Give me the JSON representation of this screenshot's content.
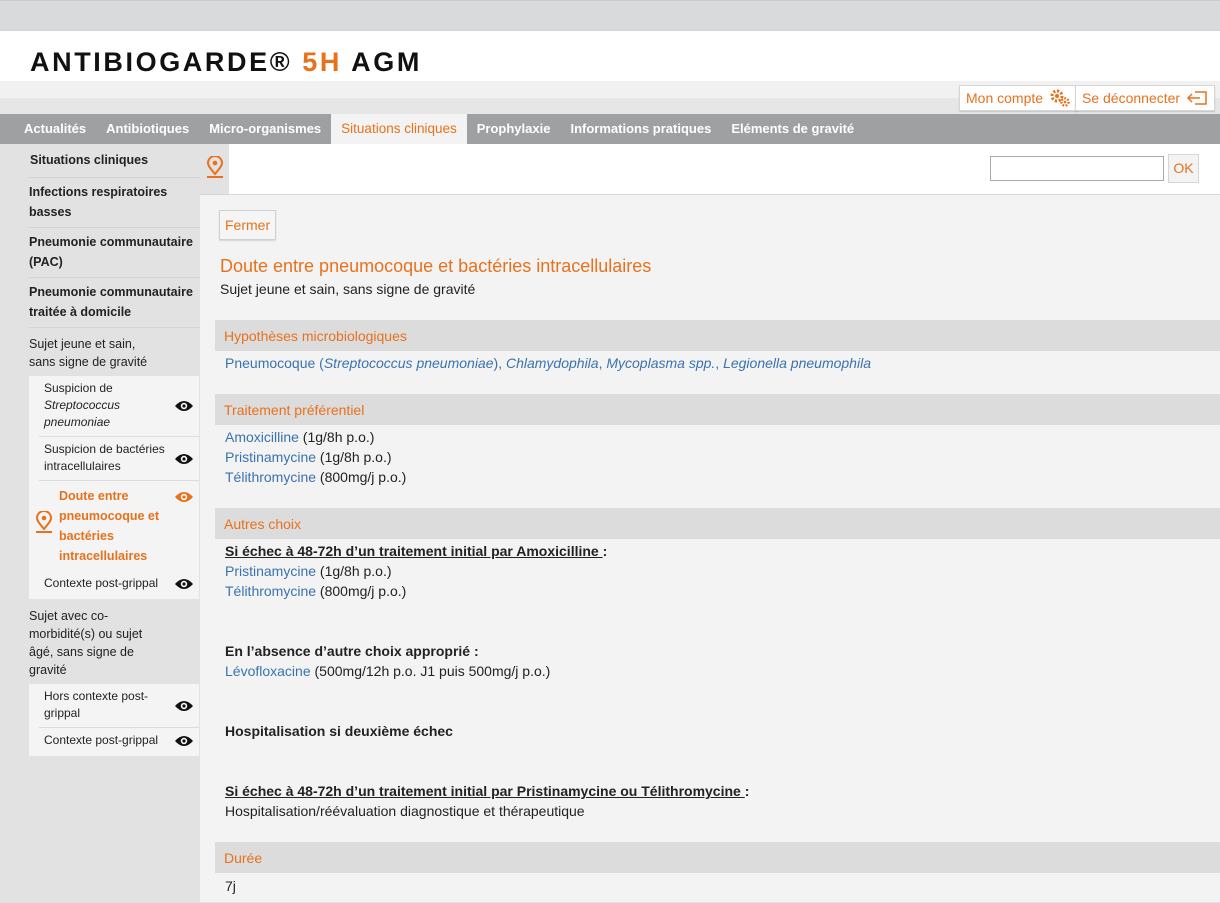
{
  "brand": {
    "part1": "ANTIBIOGARDE® ",
    "part2": "5H",
    "part3": " AGM"
  },
  "user": {
    "account": "Mon compte",
    "logout": "Se déconnecter"
  },
  "nav": [
    "Actualités",
    "Antibiotiques",
    "Micro-organismes",
    "Situations cliniques",
    "Prophylaxie",
    "Informations pratiques",
    "Eléments de gravité"
  ],
  "nav_active": "Situations cliniques",
  "sidebar": {
    "l1": "Situations cliniques",
    "l2": "Infections respiratoires basses",
    "l3": "Pneumonie communautaire (PAC)",
    "l4": "Pneumonie communautaire traitée à domicile",
    "g1": "Sujet jeune et sain, sans signe de gravité",
    "g1_items": [
      {
        "a": "Suspicion de ",
        "b": "Streptococcus pneumoniae"
      },
      {
        "a": "Suspicion de bactéries intracellulaires"
      },
      {
        "a": "Doute entre pneumocoque et bactéries intracellulaires"
      },
      {
        "a": "Contexte post-grippal"
      }
    ],
    "g2": "Sujet avec co-morbidité(s) ou sujet âgé, sans signe de gravité",
    "g2_items": [
      {
        "a": "Hors contexte post-grippal"
      },
      {
        "a": "Contexte post-grippal"
      }
    ]
  },
  "search": {
    "value": "",
    "ok": "OK"
  },
  "content": {
    "close": "Fermer",
    "title": "Doute entre pneumocoque et bactéries intracellulaires",
    "subtitle": "Sujet jeune et sain, sans signe de gravité",
    "s1": "Hypothèses microbiologiques",
    "micro": {
      "a": "Pneumocoque (",
      "b": "Streptococcus pneumoniae",
      "c": ")",
      "d": ", ",
      "e": "Chlamydophila",
      "f": ", ",
      "g": "Mycoplasma spp.",
      "h": ", ",
      "i": "Legionella pneumophila"
    },
    "s2": "Traitement préférentiel",
    "t1": {
      "drug": "Amoxicilline",
      "dose": " (1g/8h p.o.)"
    },
    "t2": {
      "drug": "Pristinamycine",
      "dose": " (1g/8h p.o.)"
    },
    "t3": {
      "drug": "Télithromycine",
      "dose": " (800mg/j p.o.)"
    },
    "s3": "Autres choix",
    "a1h": "Si échec à 48-72h d’un traitement initial par Amoxicilline ",
    "colon": " :",
    "a1": {
      "drug": "Pristinamycine",
      "dose": " (1g/8h p.o.)"
    },
    "a2": {
      "drug": "Télithromycine",
      "dose": " (800mg/j p.o.)"
    },
    "a3h": "En l’absence d’autre choix approprié :",
    "a3": {
      "drug": "Lévofloxacine",
      "dose": " (500mg/12h p.o. J1 puis 500mg/j p.o.)"
    },
    "a4h": "Hospitalisation si deuxième échec",
    "a5h": "Si échec à 48-72h d’un traitement initial par Pristinamycine ou Télithromycine ",
    "a5": "Hospitalisation/réévaluation diagnostique et thérapeutique",
    "s4": "Durée",
    "duree": "7j"
  },
  "colors": {
    "accent": "#e8711c",
    "link": "#3a72b0",
    "nav_bg": "#9ea0a2"
  }
}
